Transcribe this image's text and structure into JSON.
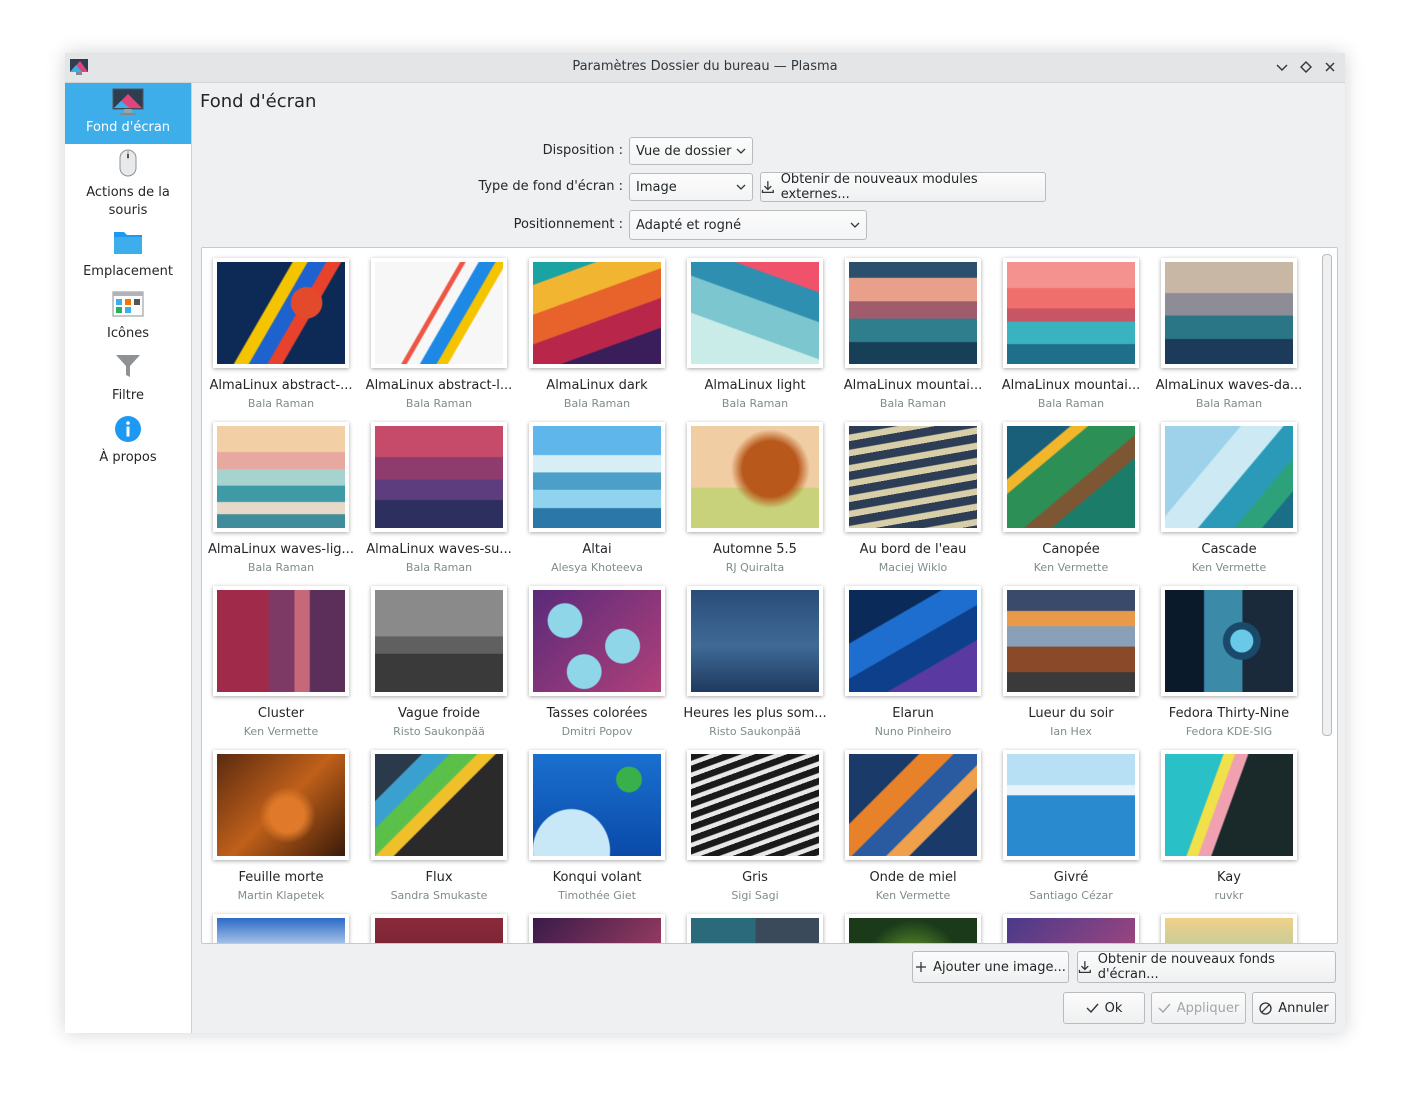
{
  "window": {
    "title": "Paramètres Dossier du bureau — Plasma"
  },
  "sidebar": {
    "items": [
      {
        "label": "Fond d'écran"
      },
      {
        "label": "Actions de la souris"
      },
      {
        "label": "Emplacement"
      },
      {
        "label": "Icônes"
      },
      {
        "label": "Filtre"
      },
      {
        "label": "À propos"
      }
    ]
  },
  "page": {
    "title": "Fond d'écran"
  },
  "form": {
    "layout_label": "Disposition :",
    "layout_value": "Vue de dossier",
    "type_label": "Type de fond d'écran :",
    "type_value": "Image",
    "plugins_button": "Obtenir de nouveaux modules externes...",
    "position_label": "Positionnement :",
    "position_value": "Adapté et rogné"
  },
  "wallpapers": [
    {
      "name": "AlmaLinux abstract-...",
      "author": "Bala Raman"
    },
    {
      "name": "AlmaLinux abstract-l...",
      "author": "Bala Raman"
    },
    {
      "name": "AlmaLinux dark",
      "author": "Bala Raman"
    },
    {
      "name": "AlmaLinux light",
      "author": "Bala Raman"
    },
    {
      "name": "AlmaLinux mountai...",
      "author": "Bala Raman"
    },
    {
      "name": "AlmaLinux mountai...",
      "author": "Bala Raman"
    },
    {
      "name": "AlmaLinux waves-da...",
      "author": "Bala Raman"
    },
    {
      "name": "AlmaLinux waves-lig...",
      "author": "Bala Raman"
    },
    {
      "name": "AlmaLinux waves-su...",
      "author": "Bala Raman"
    },
    {
      "name": "Altai",
      "author": "Alesya Khoteeva"
    },
    {
      "name": "Automne 5.5",
      "author": "RJ Quiralta"
    },
    {
      "name": "Au bord de l'eau",
      "author": "Maciej Wiklo"
    },
    {
      "name": "Canopée",
      "author": "Ken Vermette"
    },
    {
      "name": "Cascade",
      "author": "Ken Vermette"
    },
    {
      "name": "Cluster",
      "author": "Ken Vermette"
    },
    {
      "name": "Vague froide",
      "author": "Risto Saukonpää"
    },
    {
      "name": "Tasses colorées",
      "author": "Dmitri Popov"
    },
    {
      "name": "Heures les plus som...",
      "author": "Risto Saukonpää"
    },
    {
      "name": "Elarun",
      "author": "Nuno Pinheiro"
    },
    {
      "name": "Lueur du soir",
      "author": "Ian Hex"
    },
    {
      "name": "Fedora Thirty-Nine",
      "author": "Fedora KDE-SIG"
    },
    {
      "name": "Feuille morte",
      "author": "Martin Klapetek"
    },
    {
      "name": "Flux",
      "author": "Sandra Smukaste"
    },
    {
      "name": "Konqui volant",
      "author": "Timothée Giet"
    },
    {
      "name": "Gris",
      "author": "Sigi Sagi"
    },
    {
      "name": "Onde de miel",
      "author": "Ken Vermette"
    },
    {
      "name": "Givré",
      "author": "Santiago Cézar"
    },
    {
      "name": "Kay",
      "author": "ruvkr"
    }
  ],
  "actions": {
    "add_image": "Ajouter une image...",
    "get_wallpapers": "Obtenir de nouveaux fonds d'écran...",
    "ok": "Ok",
    "apply": "Appliquer",
    "cancel": "Annuler"
  }
}
